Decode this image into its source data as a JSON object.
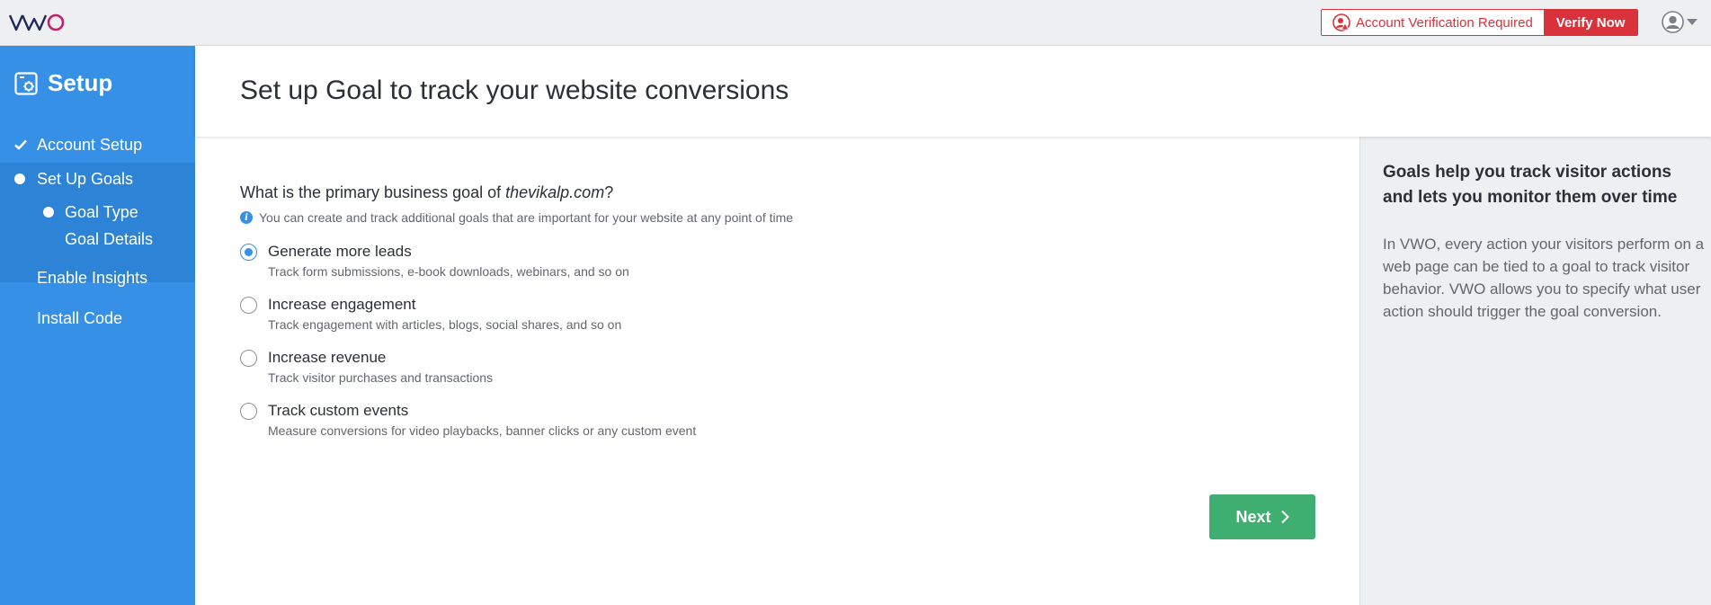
{
  "topbar": {
    "logo_text": "VWO",
    "verification_text": "Account Verification Required",
    "verify_button": "Verify Now",
    "colors": {
      "alert": "#d9323a",
      "background": "#eeeff1"
    }
  },
  "sidebar": {
    "title": "Setup",
    "items": [
      {
        "label": "Account Setup",
        "state": "completed"
      },
      {
        "label": "Set Up Goals",
        "state": "current"
      },
      {
        "label": "Enable Insights",
        "state": "pending"
      },
      {
        "label": "Install Code",
        "state": "pending"
      }
    ],
    "subitems": [
      {
        "label": "Goal Type",
        "state": "current"
      },
      {
        "label": "Goal Details",
        "state": "pending"
      }
    ],
    "colors": {
      "background": "#3590e6",
      "active": "#2d83d6"
    }
  },
  "page": {
    "title": "Set up Goal to track your website conversions"
  },
  "form": {
    "question_prefix": "What is the primary business goal of ",
    "question_domain": "thevikalp.com",
    "question_suffix": "?",
    "info_text": "You can create and track additional goals that are important for your website at any point of time",
    "options": [
      {
        "title": "Generate more leads",
        "description": "Track form submissions, e-book downloads, webinars, and so on",
        "selected": true
      },
      {
        "title": "Increase engagement",
        "description": "Track engagement with articles, blogs, social shares, and so on",
        "selected": false
      },
      {
        "title": "Increase revenue",
        "description": "Track visitor purchases and transactions",
        "selected": false
      },
      {
        "title": "Track custom events",
        "description": "Measure conversions for video playbacks, banner clicks or any custom event",
        "selected": false
      }
    ],
    "next_button": "Next",
    "colors": {
      "primary": "#3590e6",
      "next": "#3fae71"
    }
  },
  "help": {
    "title": "Goals help you track visitor actions and lets you monitor them over time",
    "body": "In VWO, every action your visitors perform on a web page can be tied to a goal to track visitor behavior. VWO allows you to specify what user action should trigger the goal conversion."
  }
}
